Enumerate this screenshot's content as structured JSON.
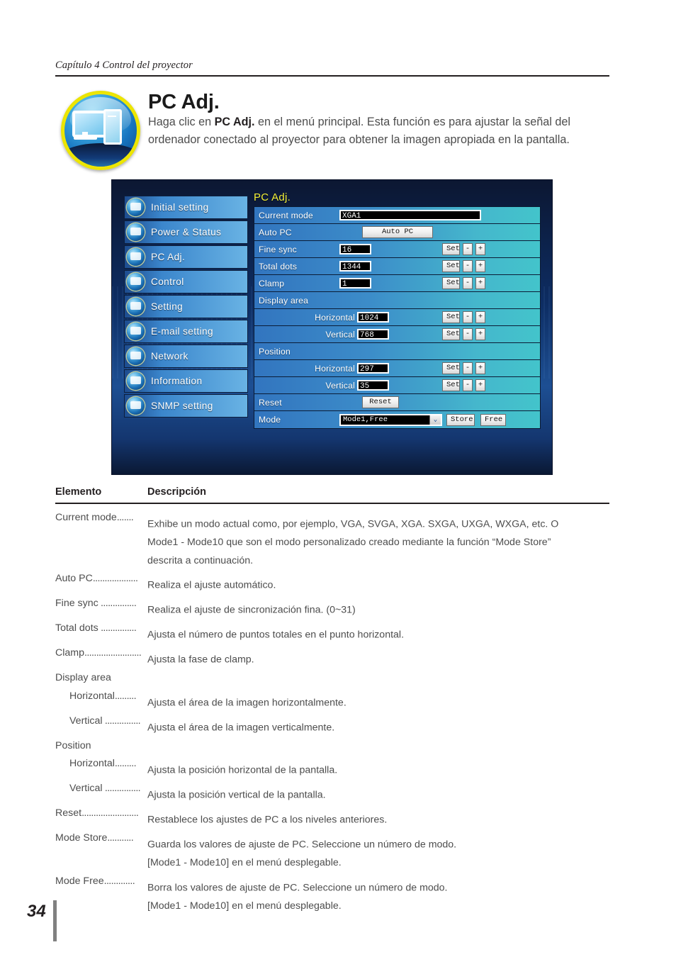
{
  "running_head": "Capítulo 4 Control del proyector",
  "hero": {
    "title": "PC Adj.",
    "body_pre": "Haga clic en ",
    "body_bold": "PC Adj.",
    "body_post": " en el menú principal. Esta función es para ajustar la señal del ordenador conectado al proyector para obtener la imagen apropiada en la pantalla.",
    "icon": "pc-monitor-tower-icon"
  },
  "screenshot": {
    "menu": [
      {
        "label": "Initial setting",
        "icon": "initial-setting-icon"
      },
      {
        "label": "Power & Status",
        "icon": "power-status-icon"
      },
      {
        "label": "PC Adj.",
        "icon": "pc-adj-icon"
      },
      {
        "label": "Control",
        "icon": "control-icon"
      },
      {
        "label": "Setting",
        "icon": "setting-icon"
      },
      {
        "label": "E-mail setting",
        "icon": "email-setting-icon"
      },
      {
        "label": "Network",
        "icon": "network-icon"
      },
      {
        "label": "Information",
        "icon": "information-icon"
      },
      {
        "label": "SNMP setting",
        "icon": "snmp-setting-icon"
      }
    ],
    "panel": {
      "title": "PC Adj.",
      "current_mode_label": "Current mode",
      "current_mode_value": "XGA1",
      "auto_pc_label": "Auto PC",
      "auto_pc_button": "Auto PC",
      "fine_sync_label": "Fine sync",
      "fine_sync_value": "16",
      "total_dots_label": "Total dots",
      "total_dots_value": "1344",
      "clamp_label": "Clamp",
      "clamp_value": "1",
      "display_area_label": "Display area",
      "display_h_label": "Horizontal",
      "display_h_value": "1024",
      "display_v_label": "Vertical",
      "display_v_value": "768",
      "position_label": "Position",
      "position_h_label": "Horizontal",
      "position_h_value": "297",
      "position_v_label": "Vertical",
      "position_v_value": "35",
      "reset_label": "Reset",
      "reset_button": "Reset",
      "mode_label": "Mode",
      "mode_value": "Mode1,Free",
      "store_button": "Store",
      "free_button": "Free",
      "set_button": "Set",
      "minus_button": "-",
      "plus_button": "+",
      "dropdown_arrow": "⌄"
    }
  },
  "table": {
    "head_element": "Elemento",
    "head_description": "Descripción",
    "rows": [
      {
        "term": "Current mode",
        "leader": ".......",
        "text": "Exhibe un modo actual como, por ejemplo, VGA, SVGA, XGA. SXGA, UXGA, WXGA, etc. O",
        "cont1": "Mode1 - Mode10 que son el modo personalizado creado mediante la función “Mode Store”",
        "cont2": "descrita a continuación."
      },
      {
        "term": "Auto PC",
        "leader": "...................",
        "text": "Realiza el ajuste automático."
      },
      {
        "term": "Fine sync",
        "leader": " ...............",
        "text": "Realiza el ajuste de sincronización fina. (0~31)"
      },
      {
        "term": "Total dots",
        "leader": " ...............",
        "text": "Ajusta el número de puntos totales en el punto horizontal."
      },
      {
        "term": "Clamp",
        "leader": "........................",
        "text": "Ajusta la fase de clamp."
      },
      {
        "plain": "Display area"
      },
      {
        "term": "Horizontal",
        "leader": ".........",
        "text": "Ajusta el área de la imagen horizontalmente.",
        "sub": true
      },
      {
        "term": "Vertical",
        "leader": " ...............",
        "text": "Ajusta el área de la imagen verticalmente.",
        "sub": true
      },
      {
        "plain": "Position"
      },
      {
        "term": "Horizontal",
        "leader": ".........",
        "text": "Ajusta la posición horizontal de la pantalla.",
        "sub": true
      },
      {
        "term": "Vertical",
        "leader": " ...............",
        "text": "Ajusta la posición vertical de la pantalla.",
        "sub": true
      },
      {
        "term": "Reset",
        "leader": "........................",
        "text": "Restablece los ajustes de PC a los niveles anteriores."
      },
      {
        "term": "Mode Store",
        "leader": "...........",
        "text": "Guarda los valores de ajuste de PC. Seleccione un número de modo.",
        "cont1": "[Mode1 - Mode10] en el menú desplegable."
      },
      {
        "term": "Mode Free",
        "leader": ".............",
        "text": "Borra los valores de ajuste de PC. Seleccione un número de modo.",
        "cont1": "[Mode1 - Mode10] en el menú desplegable."
      }
    ]
  },
  "footer": {
    "page_number": "34"
  },
  "colors": {
    "accent_yellow": "#f2ef36",
    "panel_blue": "#3275bf",
    "panel_cyan": "#43c4cb",
    "menu_blue": "#3b86cc",
    "text_gray": "#4d4d4d",
    "ink": "#231f20"
  }
}
